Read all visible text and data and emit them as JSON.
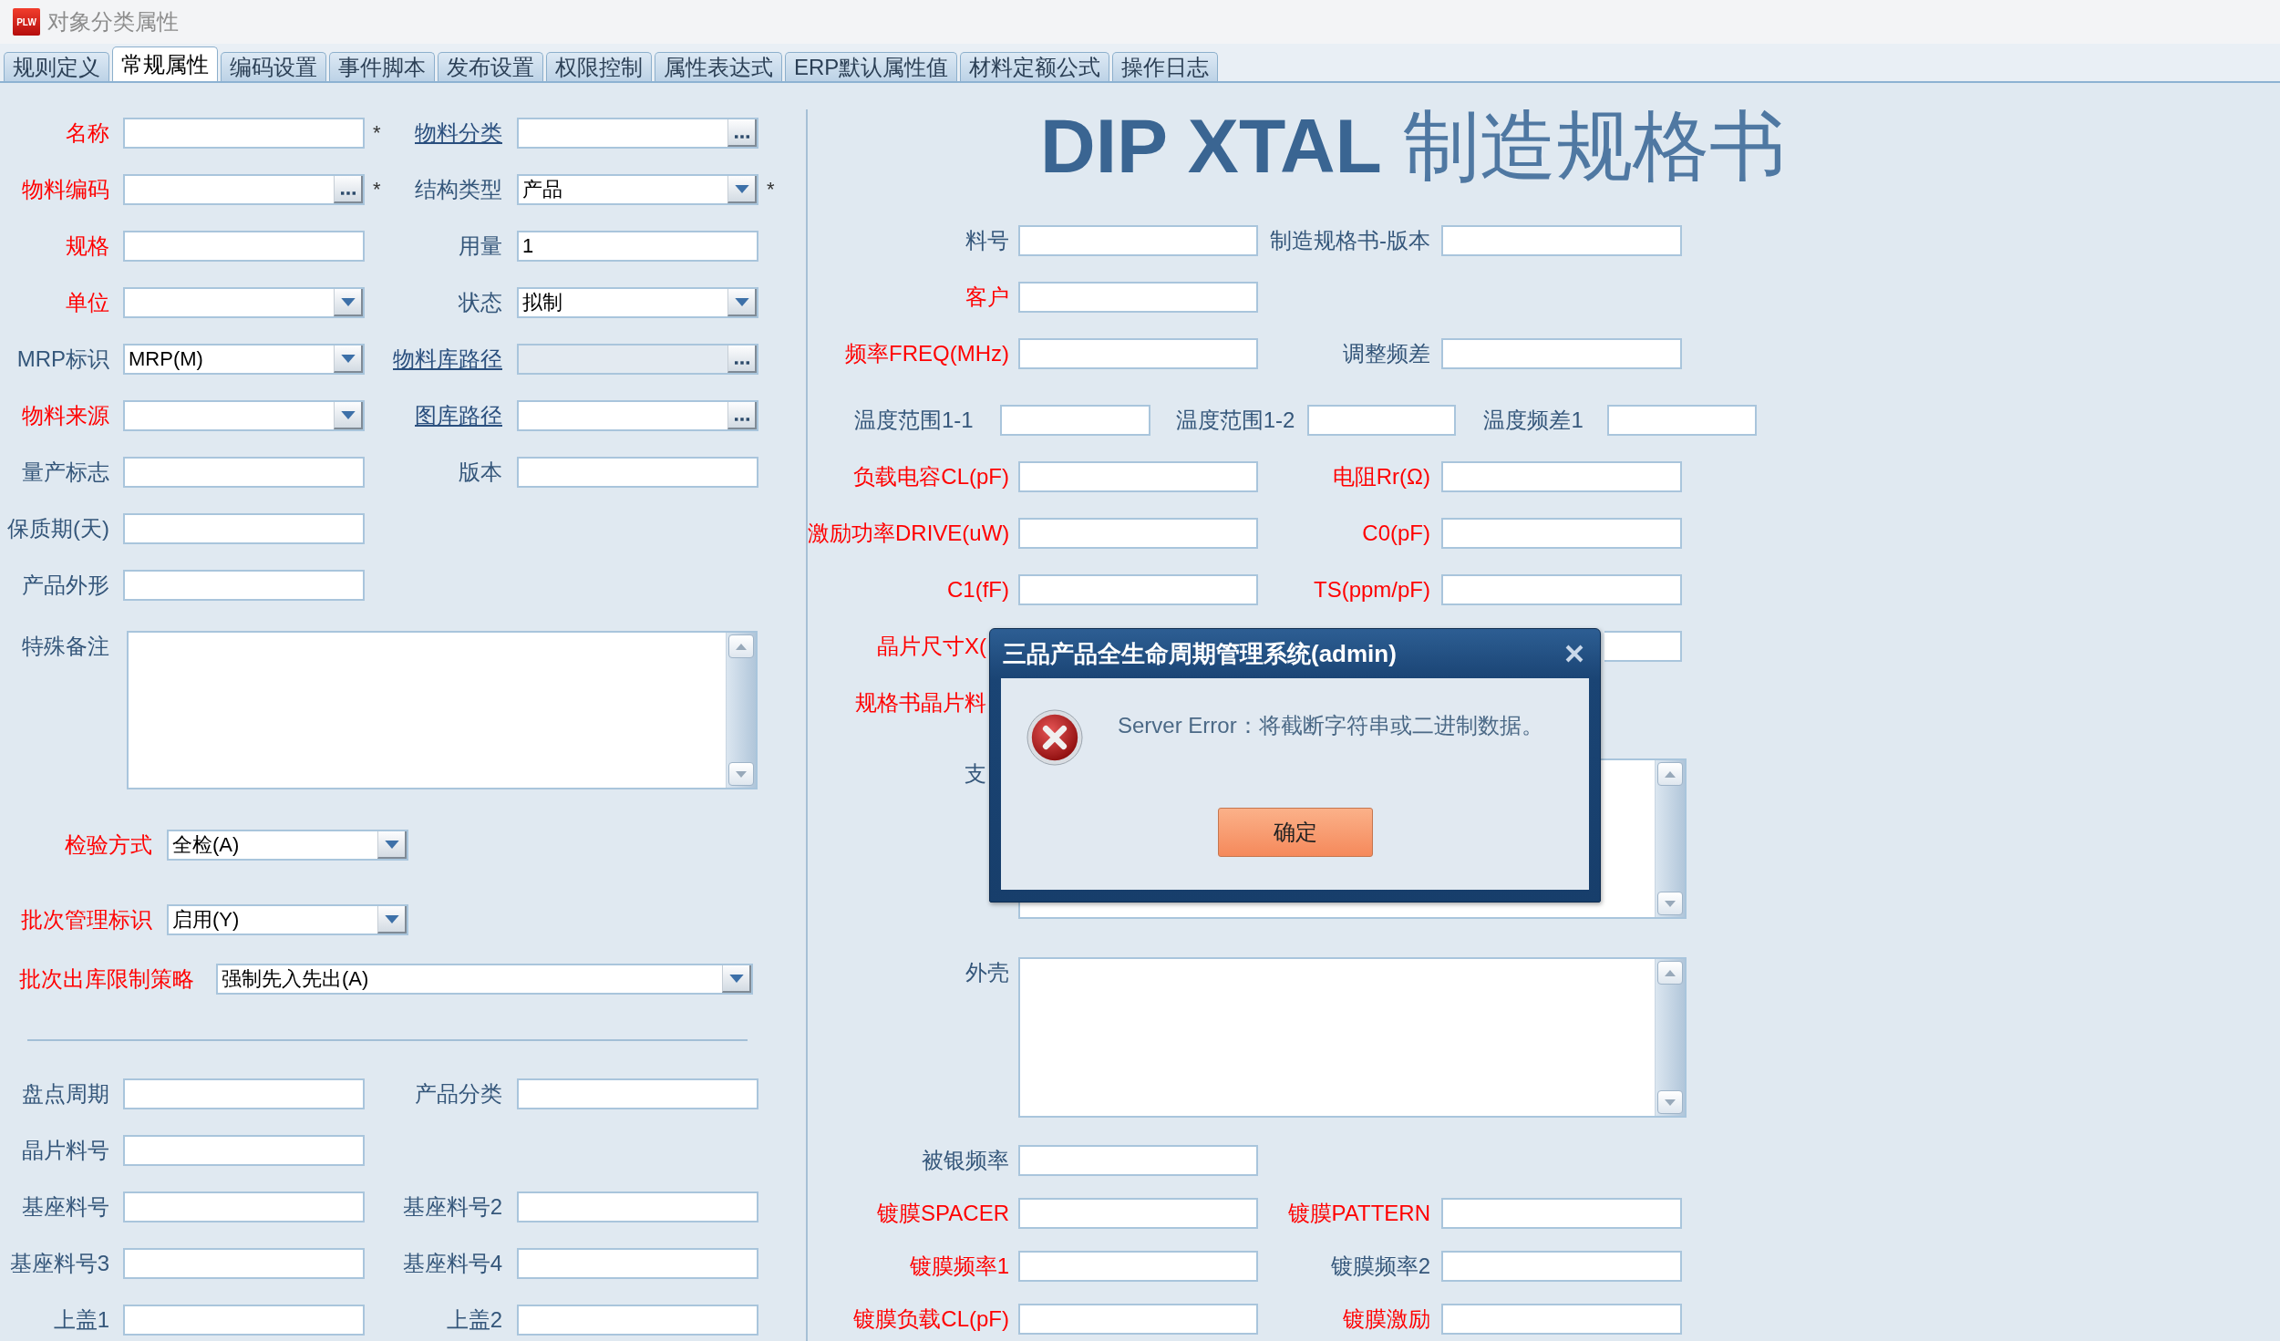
{
  "window": {
    "logo": "PLW",
    "title": "对象分类属性"
  },
  "tabs": [
    {
      "label": "规则定义",
      "selected": false
    },
    {
      "label": "常规属性",
      "selected": true
    },
    {
      "label": "编码设置",
      "selected": false
    },
    {
      "label": "事件脚本",
      "selected": false
    },
    {
      "label": "发布设置",
      "selected": false
    },
    {
      "label": "权限控制",
      "selected": false
    },
    {
      "label": "属性表达式",
      "selected": false
    },
    {
      "label": "ERP默认属性值",
      "selected": false
    },
    {
      "label": "材料定额公式",
      "selected": false
    },
    {
      "label": "操作日志",
      "selected": false
    }
  ],
  "basic": {
    "rows": [
      {
        "fields": [
          {
            "label": "名称",
            "kind": "text",
            "required": true,
            "link": false,
            "disabled": false,
            "suffix": "*"
          },
          {
            "label": "物料分类",
            "kind": "lookup",
            "required": false,
            "link": true,
            "disabled": false
          }
        ]
      },
      {
        "fields": [
          {
            "label": "物料编码",
            "kind": "lookup",
            "required": true,
            "link": false,
            "disabled": false,
            "suffix": "*"
          },
          {
            "label": "结构类型",
            "kind": "select",
            "required": false,
            "link": false,
            "disabled": false,
            "value": "产品",
            "suffix": "*"
          }
        ]
      },
      {
        "fields": [
          {
            "label": "规格",
            "kind": "text",
            "required": true,
            "link": false,
            "disabled": false
          },
          {
            "label": "用量",
            "kind": "text",
            "required": false,
            "link": false,
            "disabled": false,
            "value": "1"
          }
        ]
      },
      {
        "fields": [
          {
            "label": "单位",
            "kind": "select",
            "required": true,
            "link": false,
            "disabled": false
          },
          {
            "label": "状态",
            "kind": "select",
            "required": false,
            "link": false,
            "disabled": false,
            "value": "拟制"
          }
        ]
      },
      {
        "fields": [
          {
            "label": "MRP标识",
            "kind": "select",
            "required": false,
            "link": false,
            "disabled": false,
            "value": "MRP(M)"
          },
          {
            "label": "物料库路径",
            "kind": "lookup",
            "required": false,
            "link": true,
            "disabled": true
          }
        ]
      },
      {
        "fields": [
          {
            "label": "物料来源",
            "kind": "select",
            "required": true,
            "link": false,
            "disabled": false
          },
          {
            "label": "图库路径",
            "kind": "lookup",
            "required": false,
            "link": true,
            "disabled": false
          }
        ]
      },
      {
        "fields": [
          {
            "label": "量产标志",
            "kind": "text",
            "required": false,
            "link": false,
            "disabled": false
          },
          {
            "label": "版本",
            "kind": "text",
            "required": false,
            "link": false,
            "disabled": false
          }
        ]
      },
      {
        "fields": [
          {
            "label": "保质期(天)",
            "kind": "text",
            "required": false,
            "link": false,
            "disabled": false
          }
        ]
      },
      {
        "fields": [
          {
            "label": "产品外形",
            "kind": "text",
            "required": false,
            "link": false,
            "disabled": false
          }
        ]
      },
      {
        "fields": [
          {
            "label": "特殊备注",
            "kind": "memo",
            "required": false,
            "link": false,
            "disabled": false
          }
        ]
      }
    ]
  },
  "options": {
    "rows": [
      {
        "kind": "short",
        "fields": [
          {
            "label": "检验方式",
            "kind": "select",
            "required": true,
            "link": false,
            "disabled": false,
            "value": "全检(A)"
          }
        ]
      },
      {
        "kind": "short",
        "fields": [
          {
            "label": "批次管理标识",
            "kind": "select",
            "required": true,
            "link": false,
            "disabled": false,
            "value": "启用(Y)"
          }
        ]
      },
      {
        "kind": "wide",
        "fields": [
          {
            "label": "批次出库限制策略",
            "kind": "select",
            "required": true,
            "link": false,
            "disabled": false,
            "value": "强制先入先出(A)"
          }
        ]
      }
    ]
  },
  "extra": {
    "rows": [
      {
        "fields": [
          {
            "label": "盘点周期",
            "kind": "text",
            "required": false,
            "link": false,
            "disabled": false
          },
          {
            "label": "产品分类",
            "kind": "text",
            "required": false,
            "link": false,
            "disabled": false
          }
        ]
      },
      {
        "fields": [
          {
            "label": "晶片料号",
            "kind": "text",
            "required": false,
            "link": false,
            "disabled": false
          }
        ]
      },
      {
        "fields": [
          {
            "label": "基座料号",
            "kind": "text",
            "required": false,
            "link": false,
            "disabled": false
          },
          {
            "label": "基座料号2",
            "kind": "text",
            "required": false,
            "link": false,
            "disabled": false
          }
        ]
      },
      {
        "fields": [
          {
            "label": "基座料号3",
            "kind": "text",
            "required": false,
            "link": false,
            "disabled": false
          },
          {
            "label": "基座料号4",
            "kind": "text",
            "required": false,
            "link": false,
            "disabled": false
          }
        ]
      },
      {
        "fields": [
          {
            "label": "上盖1",
            "kind": "text",
            "required": false,
            "link": false,
            "disabled": false
          },
          {
            "label": "上盖2",
            "kind": "text",
            "required": false,
            "link": false,
            "disabled": false
          }
        ]
      }
    ]
  },
  "spec": {
    "heading": "**DIP XTAL** 制造规格书",
    "rows": [
      {
        "kind": "normal",
        "fields": [
          {
            "label": "料号",
            "kind": "text",
            "required": false,
            "link": false,
            "disabled": false
          },
          {
            "label": "制造规格书-版本",
            "kind": "text",
            "required": false,
            "link": false,
            "disabled": false
          }
        ]
      },
      {
        "kind": "normal",
        "fields": [
          {
            "label": "客户",
            "kind": "text",
            "required": true,
            "link": false,
            "disabled": false
          }
        ]
      },
      {
        "kind": "normal",
        "fields": [
          {
            "label": "频率FREQ(MHz)",
            "kind": "text",
            "required": true,
            "link": false,
            "disabled": false
          },
          {
            "label": "调整频差",
            "kind": "text",
            "required": false,
            "link": false,
            "disabled": false
          }
        ]
      },
      {
        "kind": "triple",
        "fields": [
          {
            "label": "温度范围1-1",
            "kind": "text",
            "required": false,
            "link": false,
            "disabled": false
          },
          {
            "label": "温度范围1-2",
            "kind": "text",
            "required": false,
            "link": false,
            "disabled": false
          },
          {
            "label": "温度频差1",
            "kind": "text",
            "required": false,
            "link": false,
            "disabled": false
          }
        ]
      },
      {
        "kind": "normal",
        "fields": [
          {
            "label": "负载电容CL(pF)",
            "kind": "text",
            "required": true,
            "link": false,
            "disabled": false
          },
          {
            "label": "电阻Rr(Ω)",
            "kind": "text",
            "required": true,
            "link": false,
            "disabled": false
          }
        ]
      },
      {
        "kind": "normal",
        "fields": [
          {
            "label": "激励功率DRIVE(uW)",
            "kind": "text",
            "required": true,
            "link": false,
            "disabled": false
          },
          {
            "label": "C0(pF)",
            "kind": "text",
            "required": true,
            "link": false,
            "disabled": false
          }
        ]
      },
      {
        "kind": "normal",
        "fields": [
          {
            "label": "C1(fF)",
            "kind": "text",
            "required": true,
            "link": false,
            "disabled": false
          },
          {
            "label": "TS(ppm/pF)",
            "kind": "text",
            "required": true,
            "link": false,
            "disabled": false
          }
        ]
      },
      {
        "kind": "covered",
        "fields": [
          {
            "label": "晶片尺寸X(",
            "required": true,
            "link": false
          },
          {
            "kind": "text",
            "disabled": false
          }
        ]
      },
      {
        "kind": "covered",
        "fields": [
          {
            "label": "规格书晶片料",
            "required": true,
            "link": false
          }
        ]
      },
      {
        "kind": "covered",
        "fields": [
          {
            "label": "支",
            "kind": "memo",
            "required": false,
            "link": false,
            "disabled": false
          }
        ]
      },
      {
        "kind": "normal",
        "fields": [
          {
            "label": "外壳",
            "kind": "memo",
            "required": false,
            "link": false,
            "disabled": false
          }
        ]
      },
      {
        "kind": "normal",
        "fields": [
          {
            "label": "被银频率",
            "kind": "text",
            "required": false,
            "link": false,
            "disabled": false
          }
        ]
      },
      {
        "kind": "normal",
        "fields": [
          {
            "label": "镀膜SPACER",
            "kind": "text",
            "required": true,
            "link": false,
            "disabled": false
          },
          {
            "label": "镀膜PATTERN",
            "kind": "text",
            "required": true,
            "link": false,
            "disabled": false
          }
        ]
      },
      {
        "kind": "normal",
        "fields": [
          {
            "label": "镀膜频率1",
            "kind": "text",
            "required": true,
            "link": false,
            "disabled": false
          },
          {
            "label": "镀膜频率2",
            "kind": "text",
            "required": false,
            "link": false,
            "disabled": false
          }
        ]
      },
      {
        "kind": "normal",
        "fields": [
          {
            "label": "镀膜负载CL(pF)",
            "kind": "text",
            "required": true,
            "link": false,
            "disabled": false
          },
          {
            "label": "镀膜激励",
            "kind": "text",
            "required": true,
            "link": false,
            "disabled": false
          }
        ]
      }
    ]
  },
  "dialog": {
    "title": "三品产品全生命周期管理系统(admin)",
    "message": "Server Error：将截断字符串或二进制数据。",
    "buttons": [
      "确定"
    ]
  }
}
